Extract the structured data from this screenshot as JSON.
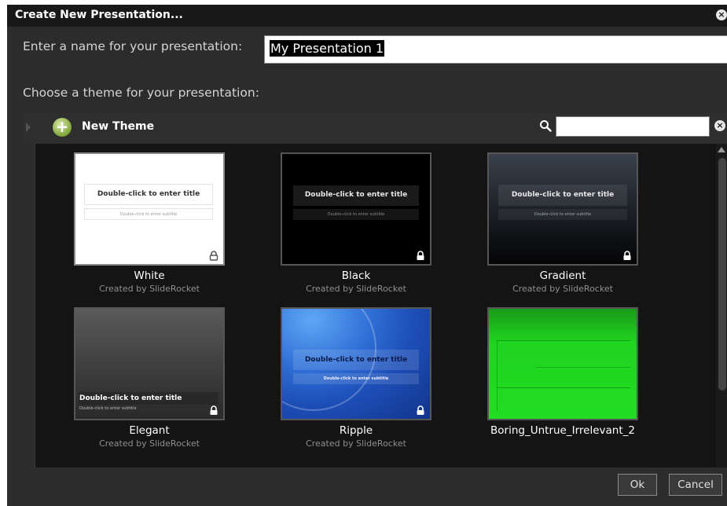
{
  "dialog": {
    "title": "Create New Presentation...",
    "name_label": "Enter a name for your presentation:",
    "name_value": "My Presentation 1",
    "theme_label": "Choose a theme for your presentation:",
    "new_theme_label": "New Theme",
    "search_placeholder": "",
    "ok_label": "Ok",
    "cancel_label": "Cancel"
  },
  "thumb_text": {
    "title": "Double-click to enter title",
    "subtitle": "Double-click to enter subtitle"
  },
  "themes": [
    {
      "name": "White",
      "creator": "Created by SlideRocket",
      "locked": true
    },
    {
      "name": "Black",
      "creator": "Created by SlideRocket",
      "locked": true
    },
    {
      "name": "Gradient",
      "creator": "Created by SlideRocket",
      "locked": true
    },
    {
      "name": "Elegant",
      "creator": "Created by SlideRocket",
      "locked": true
    },
    {
      "name": "Ripple",
      "creator": "Created by SlideRocket",
      "locked": true
    },
    {
      "name": "Boring_Untrue_Irrelevant_2",
      "creator": "",
      "locked": false
    }
  ],
  "colors": {
    "dialog_bg": "#2c2c2c",
    "titlebar_bg": "#181818",
    "gallery_bg": "#141414",
    "accent_green": "#7fa33a",
    "ripple_blue": "#1d4fb8",
    "boring_green": "#1fd31f"
  },
  "icons": [
    "close-icon",
    "add-theme-icon",
    "search-icon",
    "search-clear-icon",
    "lock-icon",
    "scroll-up-icon",
    "collapse-arrow-icon"
  ]
}
